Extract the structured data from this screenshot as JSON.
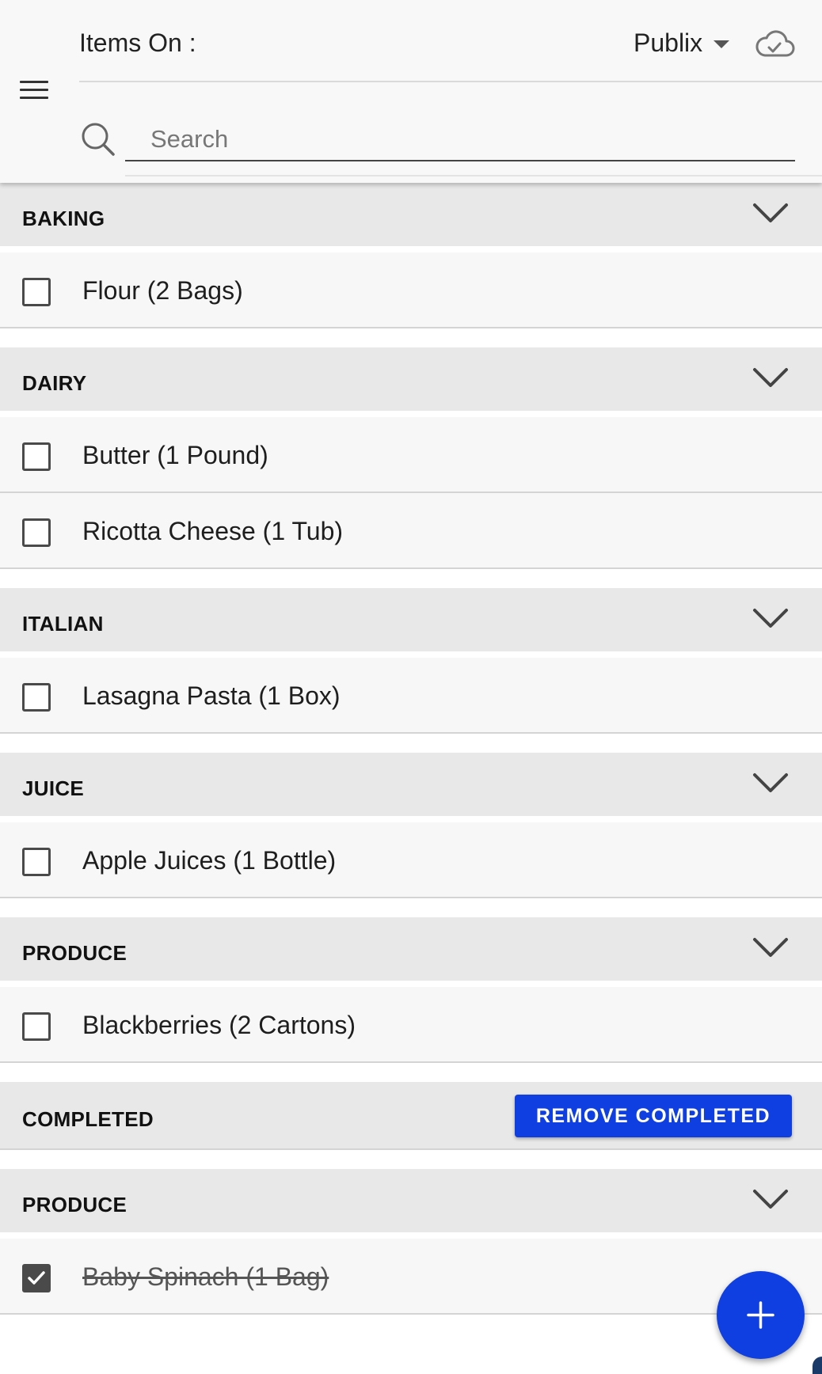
{
  "header": {
    "items_on_label": "Items On :",
    "store": "Publix",
    "cloud_status_icon": "cloud-check-icon",
    "menu_icon": "hamburger-menu-icon"
  },
  "search": {
    "placeholder": "Search",
    "value": ""
  },
  "sections": [
    {
      "title": "BAKING",
      "items": [
        {
          "label": "Flour (2 Bags)",
          "checked": false
        }
      ]
    },
    {
      "title": "DAIRY",
      "items": [
        {
          "label": "Butter (1 Pound)",
          "checked": false
        },
        {
          "label": "Ricotta Cheese (1 Tub)",
          "checked": false
        }
      ]
    },
    {
      "title": "ITALIAN",
      "items": [
        {
          "label": "Lasagna Pasta (1 Box)",
          "checked": false
        }
      ]
    },
    {
      "title": "JUICE",
      "items": [
        {
          "label": "Apple Juices (1 Bottle)",
          "checked": false
        }
      ]
    },
    {
      "title": "PRODUCE",
      "items": [
        {
          "label": "Blackberries (2 Cartons)",
          "checked": false
        }
      ]
    }
  ],
  "completed": {
    "title": "COMPLETED",
    "remove_button": "REMOVE COMPLETED",
    "sections": [
      {
        "title": "PRODUCE",
        "items": [
          {
            "label": "Baby Spinach (1 Bag)",
            "checked": true
          }
        ]
      }
    ]
  },
  "fab": {
    "icon": "plus-icon"
  },
  "colors": {
    "accent": "#0f3fe0",
    "header_bg": "#f8f8f8",
    "section_bg": "#e8e8e8",
    "row_bg": "#f7f7f7"
  }
}
